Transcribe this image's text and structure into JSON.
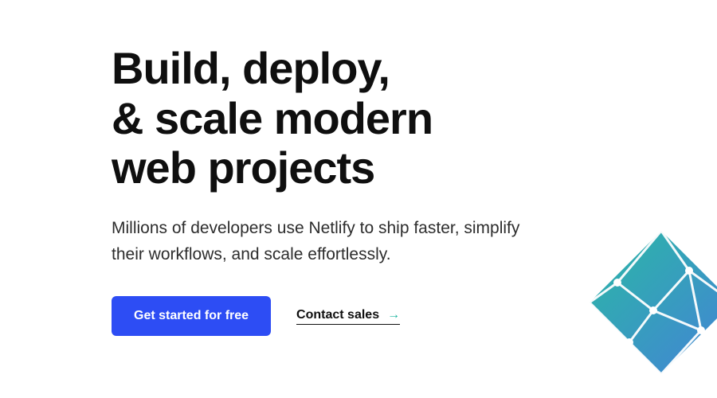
{
  "hero": {
    "headline_line1": "Build, deploy,",
    "headline_line2": "& scale modern",
    "headline_line3": "web projects",
    "subhead": "Millions of developers use Netlify to ship faster, simplify their workflows, and scale effortlessly.",
    "cta_primary": "Get started for free",
    "cta_secondary": "Contact sales"
  },
  "colors": {
    "primary_button": "#2d4df4",
    "arrow": "#1fb5a0",
    "logo_gradient_start": "#1fb5a0",
    "logo_gradient_end": "#3a7bd5"
  }
}
